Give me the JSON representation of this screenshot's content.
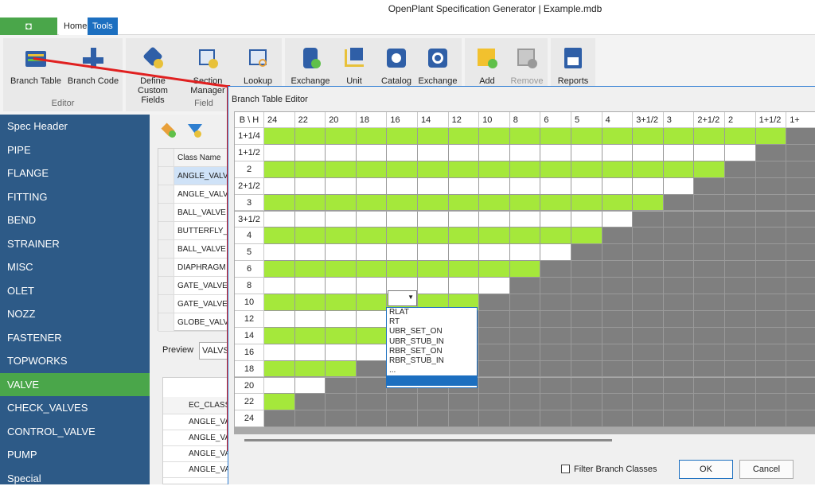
{
  "window": {
    "title": "OpenPlant Specification Generator | Example.mdb"
  },
  "menu": {
    "file_icon": "app-logo-icon",
    "tabs": [
      "Home",
      "Tools"
    ]
  },
  "ribbon": {
    "groups": [
      {
        "label": "Editor",
        "buttons": [
          "Branch Table",
          "Branch Code"
        ]
      },
      {
        "label": "Field",
        "buttons": [
          "Define Custom Fields",
          "Section Manager",
          "Lookup"
        ]
      },
      {
        "label": "",
        "buttons": [
          "Exchange",
          "Unit",
          "Catalog",
          "Exchange"
        ]
      },
      {
        "label": "",
        "buttons": [
          "Add",
          "Remove"
        ]
      },
      {
        "label": "",
        "buttons": [
          "Reports"
        ]
      }
    ]
  },
  "sidebar": {
    "items": [
      "Spec Header",
      "PIPE",
      "FLANGE",
      "FITTING",
      "BEND",
      "STRAINER",
      "MISC",
      "OLET",
      "NOZZ",
      "FASTENER",
      "TOPWORKS",
      "VALVE",
      "CHECK_VALVES",
      "CONTROL_VALVE",
      "PUMP",
      "Special"
    ],
    "active": "VALVE"
  },
  "middle": {
    "class_header": "Class Name",
    "rows": [
      "ANGLE_VALVE",
      "ANGLE_VALVE",
      "BALL_VALVE",
      "BUTTERFLY_VALVE",
      "BALL_VALVE",
      "DIAPHRAGM",
      "GATE_VALVE",
      "GATE_VALVE",
      "GLOBE_VALVE"
    ],
    "preview_label": "Preview",
    "preview_value": "VALVS",
    "bottom_header": "EC_CLASS",
    "bottom_rows": [
      "ANGLE_VA",
      "ANGLE_VA",
      "ANGLE_VA",
      "ANGLE_VA"
    ]
  },
  "dialog": {
    "title": "Branch Table Editor",
    "corner": "B \\ H",
    "headers": [
      "24",
      "22",
      "20",
      "18",
      "16",
      "14",
      "12",
      "10",
      "8",
      "6",
      "5",
      "4",
      "3+1/2",
      "3",
      "2+1/2",
      "2",
      "1+1/2",
      "1+"
    ],
    "rows": [
      "1+1/4",
      "1+1/2",
      "2",
      "2+1/2",
      "3",
      "3+1/2",
      "4",
      "5",
      "6",
      "8",
      "10",
      "12",
      "14",
      "16",
      "18",
      "20",
      "22",
      "24"
    ],
    "dropdown_options": [
      "RLAT",
      "RT",
      "UBR_SET_ON",
      "UBR_STUB_IN",
      "RBR_SET_ON",
      "RBR_STUB_IN",
      "..."
    ],
    "filter_label": "Filter Branch Classes",
    "ok_label": "OK",
    "cancel_label": "Cancel",
    "colors": {
      "green": "#a5e83b",
      "white": "#ffffff",
      "gray": "#7f7f7f",
      "accent": "#1c6fc0",
      "sidebar": "#2d5a87",
      "active": "#4aa64a"
    }
  }
}
